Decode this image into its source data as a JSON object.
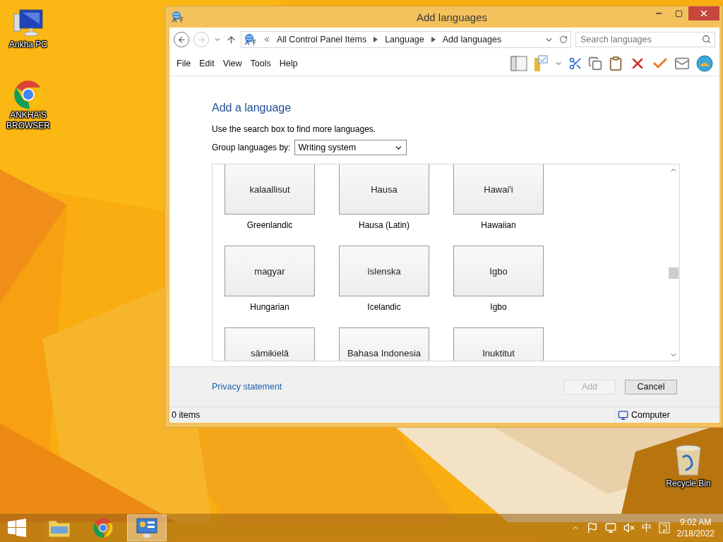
{
  "desktop_icons": [
    {
      "label": "Ankha PC",
      "kind": "computer"
    },
    {
      "label": "ANKHA'S BROWSER",
      "kind": "browser"
    },
    {
      "label": "Recycle Bin",
      "kind": "recycle"
    }
  ],
  "window": {
    "title": "Add languages",
    "address": [
      "All Control Panel Items",
      "Language",
      "Add languages"
    ],
    "search": {
      "placeholder": "Search languages"
    },
    "menu": [
      "File",
      "Edit",
      "View",
      "Tools",
      "Help"
    ],
    "heading": "Add a language",
    "hint": "Use the search box to find more languages.",
    "group_label": "Group languages by:",
    "group_value": "Writing system",
    "languages": [
      {
        "native": "kalaallisut",
        "name": "Greenlandic"
      },
      {
        "native": "Hausa",
        "name": "Hausa (Latin)"
      },
      {
        "native": "Hawai'i",
        "name": "Hawaiian"
      },
      {
        "native": "magyar",
        "name": "Hungarian"
      },
      {
        "native": "íslenska",
        "name": "Icelandic"
      },
      {
        "native": "Igbo",
        "name": "Igbo"
      },
      {
        "native": "sämikielâ"
      },
      {
        "native": "Bahasa Indonesia"
      },
      {
        "native": "Inuktitut"
      }
    ],
    "privacy_link": "Privacy statement",
    "buttons": [
      {
        "label": "Add",
        "disabled": true
      },
      {
        "label": "Cancel",
        "disabled": false
      }
    ],
    "status_bar": {
      "items": "0 items",
      "location": "Computer"
    }
  },
  "taskbar": {
    "apps": [
      {
        "kind": "explorer",
        "selected": false
      },
      {
        "kind": "chrome",
        "selected": false
      },
      {
        "kind": "control-panel",
        "selected": true
      }
    ],
    "ime": "中",
    "time": "9:02 AM",
    "date": "2/18/2022"
  }
}
